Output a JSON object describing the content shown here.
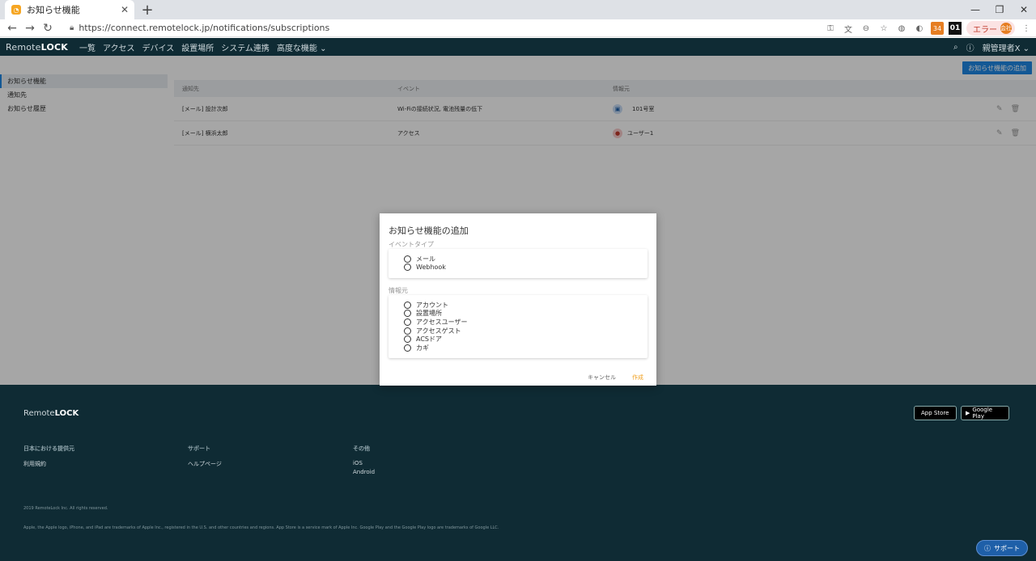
{
  "browser": {
    "tab_title": "お知らせ機能",
    "new_tab": "+",
    "url": "https://connect.remotelock.jp/notifications/subscriptions",
    "ext_badge": "34",
    "ext_text": "01",
    "error_label": "エラー",
    "error_avatar": "会社"
  },
  "nav": {
    "logo_prefix": "Remote",
    "logo_suffix": "LOCK",
    "items": [
      "一覧",
      "アクセス",
      "デバイス",
      "設置場所",
      "システム連携",
      "高度な機能 ⌄"
    ],
    "user": "親管理者X ⌄"
  },
  "page": {
    "add_button": "お知らせ機能の追加",
    "sidebar": [
      "お知らせ機能",
      "通知先",
      "お知らせ履歴"
    ],
    "columns": [
      "通知先",
      "イベント",
      "情報元"
    ],
    "rows": [
      {
        "target": "[メール] 設計次郎",
        "event": "Wi-Fiの接続状況, 電池残量の低下",
        "source": "101号室"
      },
      {
        "target": "[メール] 横浜太郎",
        "event": "アクセス",
        "source": "ユーザー1"
      }
    ]
  },
  "modal": {
    "title": "お知らせ機能の追加",
    "event_type_label": "イベントタイプ",
    "event_types": [
      "メール",
      "Webhook"
    ],
    "source_label": "情報元",
    "sources": [
      "アカウント",
      "設置場所",
      "アクセスユーザー",
      "アクセスゲスト",
      "ACSドア",
      "カギ"
    ],
    "cancel": "キャンセル",
    "create": "作成"
  },
  "footer": {
    "logo_prefix": "Remote",
    "logo_suffix": "LOCK",
    "app_store": "App Store",
    "google_play": "Google Play",
    "col1_heading": "日本における提供元",
    "col1_link": "利用規約",
    "col2_heading": "サポート",
    "col2_link": "ヘルプページ",
    "col3_heading": "その他",
    "col3_links": [
      "iOS",
      "Android"
    ],
    "copyright": "2019 RemoteLock Inc. All rights reserved.",
    "legal": "Apple, the Apple logo, iPhone, and iPad are trademarks of Apple Inc., registered in the U.S. and other countries and regions. App Store is a service mark of Apple Inc. Google Play and the Google Play logo are trademarks of Google LLC.",
    "support": "サポート"
  }
}
